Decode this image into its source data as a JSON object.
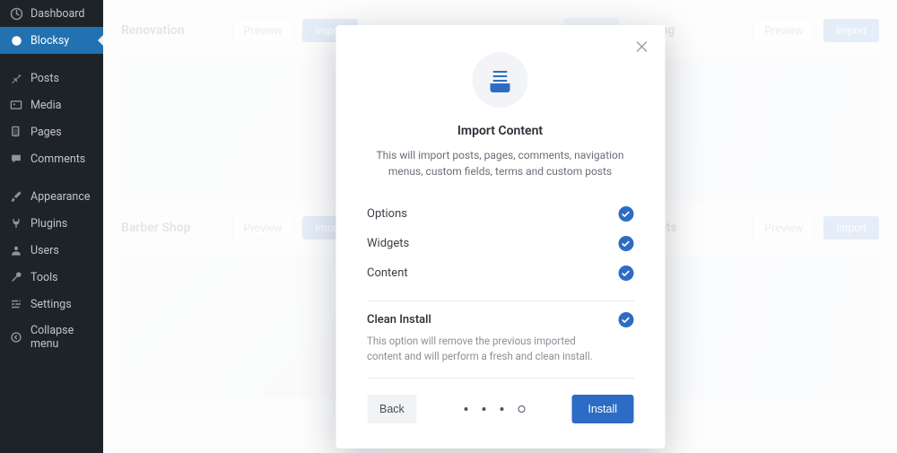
{
  "sidebar": {
    "items": [
      {
        "label": "Dashboard",
        "active": false
      },
      {
        "label": "Blocksy",
        "active": true
      },
      {
        "label": "Posts"
      },
      {
        "label": "Media"
      },
      {
        "label": "Pages"
      },
      {
        "label": "Comments"
      },
      {
        "label": "Appearance"
      },
      {
        "label": "Plugins"
      },
      {
        "label": "Users"
      },
      {
        "label": "Tools"
      },
      {
        "label": "Settings"
      },
      {
        "label": "Collapse menu"
      }
    ]
  },
  "templates": {
    "preview_label": "Preview",
    "import_label": "Import",
    "cards": [
      {
        "title": "Renovation"
      },
      {
        "title": ""
      },
      {
        "title": "tering"
      },
      {
        "title": "Barber Shop"
      },
      {
        "title": ""
      },
      {
        "title": "idgets"
      }
    ]
  },
  "modal": {
    "title": "Import Content",
    "description": "This will import posts, pages, comments, navigation menus, custom fields, terms and custom posts",
    "options": [
      {
        "label": "Options",
        "checked": true
      },
      {
        "label": "Widgets",
        "checked": true
      },
      {
        "label": "Content",
        "checked": true
      }
    ],
    "clean_install": {
      "label": "Clean Install",
      "description": "This option will remove the previous imported content and will perform a fresh and clean install.",
      "checked": true
    },
    "back_label": "Back",
    "install_label": "Install",
    "step_current": 4,
    "step_total": 4
  }
}
